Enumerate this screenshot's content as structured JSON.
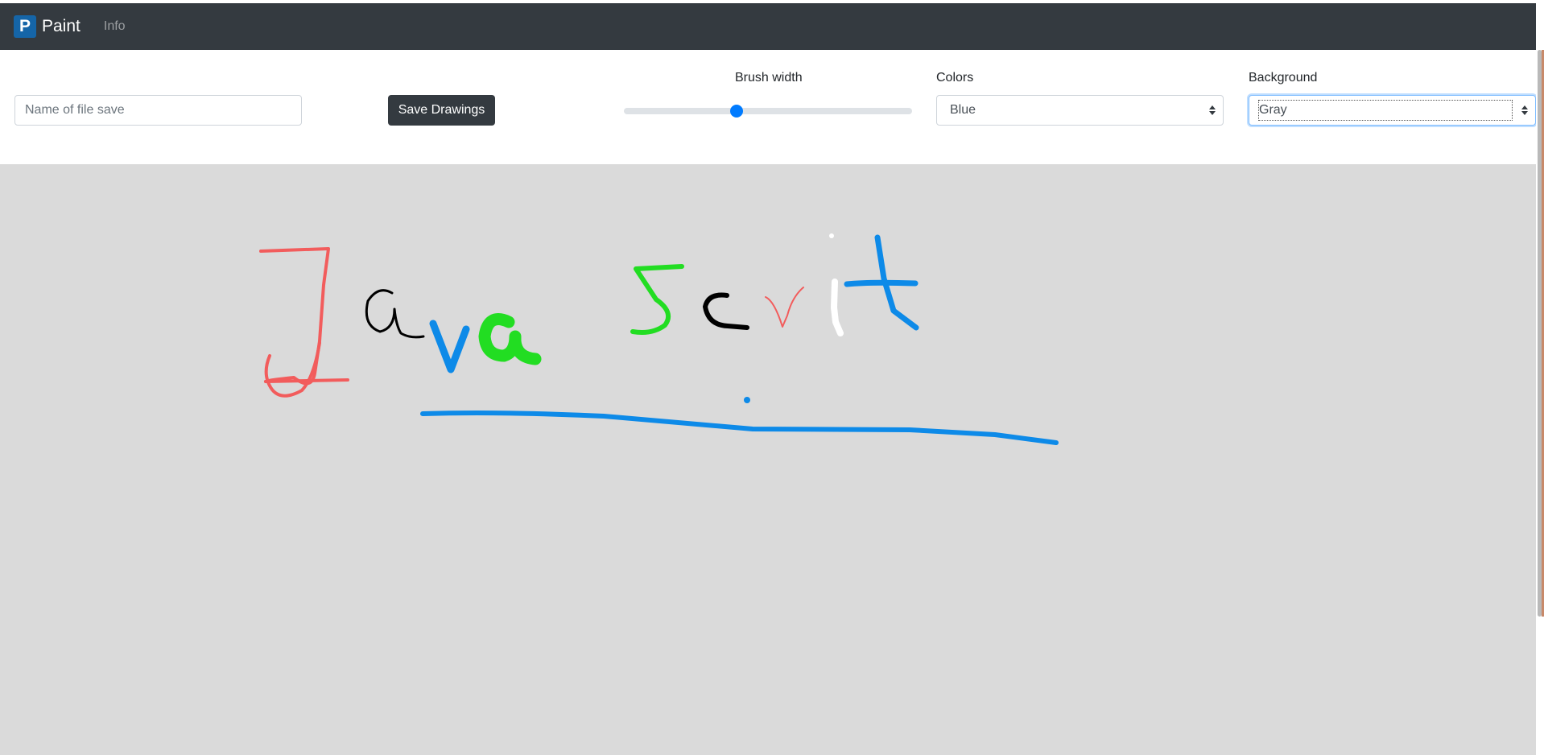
{
  "navbar": {
    "logo_letter": "P",
    "brand": "Paint",
    "links": [
      "Info"
    ]
  },
  "toolbar": {
    "file_input_placeholder": "Name of file save",
    "file_input_value": "",
    "save_button_label": "Save Drawings",
    "brush_width_label": "Brush width",
    "brush_width_value": 0.39,
    "colors_label": "Colors",
    "colors_selected": "Blue",
    "background_label": "Background",
    "background_selected": "Gray"
  },
  "canvas": {
    "background_color": "#dadada",
    "stroke_colors": {
      "red": "#f25c5c",
      "black": "#000000",
      "blue": "#0d8ae8",
      "green": "#22dd22",
      "white": "#ffffff"
    }
  },
  "colors": {
    "navbar_bg": "#343a40",
    "logo_bg": "#1565a8",
    "accent": "#007bff"
  }
}
